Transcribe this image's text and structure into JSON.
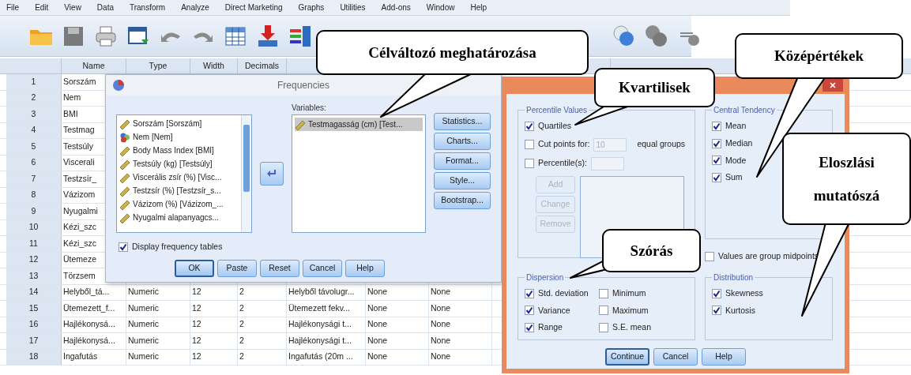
{
  "menu": [
    "File",
    "Edit",
    "View",
    "Data",
    "Transform",
    "Analyze",
    "Direct Marketing",
    "Graphs",
    "Utilities",
    "Add-ons",
    "Window",
    "Help"
  ],
  "grid": {
    "columns": [
      "Name",
      "Type",
      "Width",
      "Decimals"
    ],
    "rows": [
      {
        "number": "1",
        "cells": [
          "Sorszám"
        ]
      },
      {
        "number": "2",
        "cells": [
          "Nem"
        ]
      },
      {
        "number": "3",
        "cells": [
          "BMI"
        ]
      },
      {
        "number": "4",
        "cells": [
          "Testmag"
        ]
      },
      {
        "number": "5",
        "cells": [
          "Testsúly"
        ]
      },
      {
        "number": "6",
        "cells": [
          "Viscerali"
        ]
      },
      {
        "number": "7",
        "cells": [
          "Testzsír_"
        ]
      },
      {
        "number": "8",
        "cells": [
          "Vázizom"
        ]
      },
      {
        "number": "9",
        "cells": [
          "Nyugalmi"
        ]
      },
      {
        "number": "10",
        "cells": [
          "Kézi_szc"
        ]
      },
      {
        "number": "11",
        "cells": [
          "Kézi_szc"
        ]
      },
      {
        "number": "12",
        "cells": [
          "Ütemeze"
        ]
      },
      {
        "number": "13",
        "cells": [
          "Törzsem"
        ]
      },
      {
        "number": "14",
        "cells": [
          "Helyből_tá...",
          "Numeric",
          "12",
          "2",
          "Helyből távolugr...",
          "None",
          "None"
        ]
      },
      {
        "number": "15",
        "cells": [
          "Ütemezett_f...",
          "Numeric",
          "12",
          "2",
          "Ütemezett fekv...",
          "None",
          "None"
        ]
      },
      {
        "number": "16",
        "cells": [
          "Hajlékonysá...",
          "Numeric",
          "12",
          "2",
          "Hajlékonysági t...",
          "None",
          "None"
        ]
      },
      {
        "number": "17",
        "cells": [
          "Hajlékonysá...",
          "Numeric",
          "12",
          "2",
          "Hajlékonysági t...",
          "None",
          "None"
        ]
      },
      {
        "number": "18",
        "cells": [
          "Ingafutás",
          "Numeric",
          "12",
          "2",
          "Ingafutás (20m ...",
          "None",
          "None"
        ]
      }
    ]
  },
  "frequencies": {
    "title": "Frequencies",
    "source_list": [
      {
        "label": "Sorszám [Sorszám]",
        "kind": "scale"
      },
      {
        "label": "Nem [Nem]",
        "kind": "nominal"
      },
      {
        "label": "Body Mass Index [BMI]",
        "kind": "scale"
      },
      {
        "label": "Testsúly (kg) [Testsúly]",
        "kind": "scale"
      },
      {
        "label": "Viscerális zsír (%) [Visc...",
        "kind": "scale"
      },
      {
        "label": "Testzsír (%) [Testzsír_s...",
        "kind": "scale"
      },
      {
        "label": "Vázizom (%) [Vázizom_...",
        "kind": "scale"
      },
      {
        "label": "Nyugalmi alapanyagcs...",
        "kind": "scale"
      }
    ],
    "variables_label": "Variables:",
    "selected_variables": [
      {
        "label": "Testmagasság (cm) [Test...",
        "kind": "scale",
        "selected": true
      }
    ],
    "side_buttons": [
      "Statistics...",
      "Charts...",
      "Format...",
      "Style...",
      "Bootstrap..."
    ],
    "display_frequency_tables": {
      "label": "Display frequency tables",
      "checked": true
    },
    "buttons": [
      {
        "label": "OK",
        "default": true
      },
      {
        "label": "Paste",
        "default": false
      },
      {
        "label": "Reset",
        "default": false
      },
      {
        "label": "Cancel",
        "default": false
      },
      {
        "label": "Help",
        "default": false
      }
    ]
  },
  "statistics": {
    "percentile_values": {
      "legend": "Percentile Values",
      "quartiles": {
        "label": "Quartiles",
        "checked": true
      },
      "cut_points": {
        "label": "Cut points for:",
        "checked": false,
        "value": "10",
        "suffix": "equal groups"
      },
      "percentiles": {
        "label": "Percentile(s):",
        "checked": false
      },
      "buttons": [
        {
          "label": "Add",
          "disabled": true
        },
        {
          "label": "Change",
          "disabled": true
        },
        {
          "label": "Remove",
          "disabled": true
        }
      ]
    },
    "central_tendency": {
      "legend": "Central Tendency",
      "items": [
        {
          "label": "Mean",
          "checked": true
        },
        {
          "label": "Median",
          "checked": true
        },
        {
          "label": "Mode",
          "checked": true
        },
        {
          "label": "Sum",
          "checked": true
        }
      ]
    },
    "group_midpoints": {
      "label": "Values are group midpoints",
      "checked": false
    },
    "dispersion": {
      "legend": "Dispersion",
      "items": [
        {
          "label": "Std. deviation",
          "checked": true
        },
        {
          "label": "Minimum",
          "checked": false
        },
        {
          "label": "Variance",
          "checked": true
        },
        {
          "label": "Maximum",
          "checked": false
        },
        {
          "label": "Range",
          "checked": true
        },
        {
          "label": "S.E. mean",
          "checked": false
        }
      ]
    },
    "distribution": {
      "legend": "Distribution",
      "items": [
        {
          "label": "Skewness",
          "checked": true
        },
        {
          "label": "Kurtosis",
          "checked": true
        }
      ]
    },
    "buttons": [
      {
        "label": "Continue",
        "default": true
      },
      {
        "label": "Cancel",
        "default": false
      },
      {
        "label": "Help",
        "default": false
      }
    ]
  },
  "callouts": [
    {
      "text": "Célváltozó meghatározása"
    },
    {
      "text": "Középértékek"
    },
    {
      "text": "Kvartilisek"
    },
    {
      "text": "Eloszlási mutatószá"
    },
    {
      "text": "Szórás"
    }
  ]
}
